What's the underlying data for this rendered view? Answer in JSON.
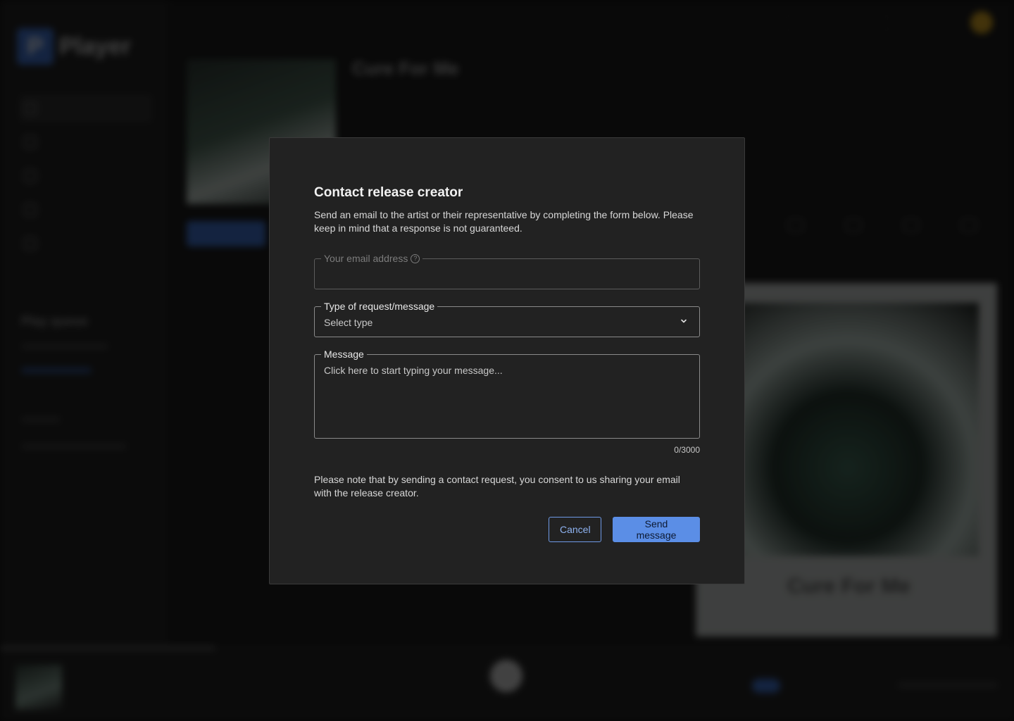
{
  "background": {
    "logo_text": "Player",
    "logo_mark": "P",
    "nav_items": [
      "",
      "",
      "",
      "",
      ""
    ],
    "play_queue_title": "Play queue",
    "release_title": "Cure For Me",
    "cover_title": "Cure For Me"
  },
  "modal": {
    "title": "Contact release creator",
    "description": "Send an email to the artist or their representative by completing the form below. Please keep in mind that a response is not guaranteed.",
    "email": {
      "label": "Your email address",
      "value": ""
    },
    "request_type": {
      "label": "Type of request/message",
      "selected": "Select type"
    },
    "message": {
      "label": "Message",
      "placeholder": "Click here to start typing your message...",
      "counter": "0/3000"
    },
    "consent_note": "Please note that by sending a contact request, you consent to us sharing your email with the release creator.",
    "cancel_label": "Cancel",
    "send_label": "Send message"
  },
  "colors": {
    "accent": "#5b8ee6",
    "modal_bg": "#222222"
  },
  "icons": {
    "help": "help-circle-icon",
    "select": "chevron-down-icon"
  }
}
